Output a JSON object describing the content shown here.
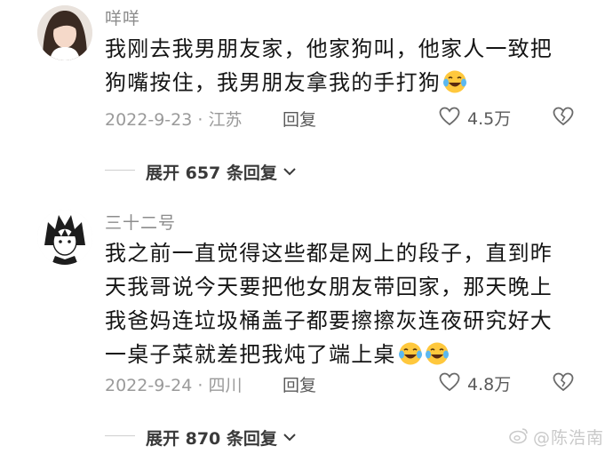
{
  "comments": [
    {
      "username": "咩咩",
      "lines": [
        "我刚去我男朋友家，他家狗叫，他家人一致把",
        "狗嘴按住，我男朋友拿我的手打狗"
      ],
      "emojis": [
        "laughing-crying-emoji"
      ],
      "date_location": "2022-9-23 · 江苏",
      "reply_label": "回复",
      "likes": "4.5万",
      "expand_label": "展开 657 条回复"
    },
    {
      "username": "三十二号",
      "lines": [
        "我之前一直觉得这些都是网上的段子，直到昨",
        "天我哥说今天要把他女朋友带回家，那天晚上",
        "我爸妈连垃圾桶盖子都要擦擦灰连夜研究好大",
        "一桌子菜就差把我炖了端上桌"
      ],
      "emojis": [
        "laughing-crying-emoji",
        "laughing-crying-emoji"
      ],
      "date_location": "2022-9-24 · 四川",
      "reply_label": "回复",
      "likes": "4.8万",
      "expand_label": "展开 870 条回复"
    }
  ],
  "watermark": "@陈浩南",
  "icons": {
    "like": "heart-outline-icon",
    "dislike": "broken-heart-icon",
    "expand": "chevron-down-icon",
    "watermark": "weibo-logo-icon"
  },
  "colors": {
    "text": "#151515",
    "secondary": "#9a9a9a",
    "emoji_face": "#ffc83d"
  }
}
